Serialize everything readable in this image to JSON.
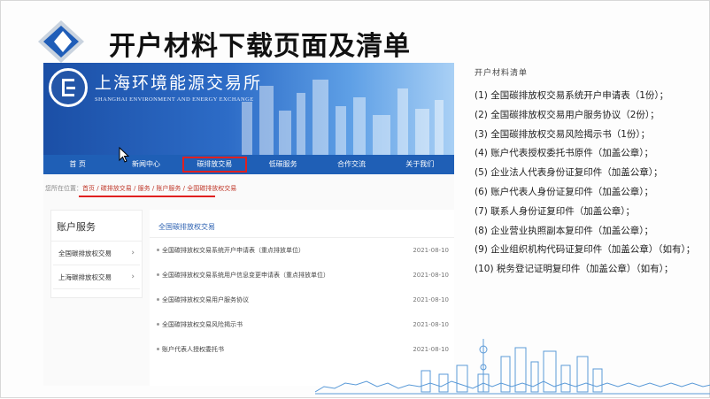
{
  "slide": {
    "title": "开户材料下载页面及清单"
  },
  "site": {
    "name_cn": "上海环境能源交易所",
    "name_en": "SHANGHAI ENVIRONMENT AND ENERGY EXCHANGE",
    "nav": [
      {
        "label": "首 页",
        "active": false
      },
      {
        "label": "新闻中心",
        "active": false
      },
      {
        "label": "碳排放交易",
        "active": true
      },
      {
        "label": "低碳服务",
        "active": false
      },
      {
        "label": "合作交流",
        "active": false
      },
      {
        "label": "关于我们",
        "active": false
      }
    ],
    "breadcrumb_prefix": "您所在位置：",
    "breadcrumb": "首页 / 碳排放交易 / 服务 / 账户服务 / 全国碳排放权交易",
    "sidebar": {
      "title": "账户服务",
      "items": [
        "全国碳排放权交易",
        "上海碳排放权交易"
      ]
    },
    "list": {
      "tab": "全国碳排放权交易",
      "rows": [
        {
          "title": "全国碳排放权交易系统开户申请表（重点排放单位）",
          "date": "2021-08-10"
        },
        {
          "title": "全国碳排放权交易系统用户信息变更申请表（重点排放单位）",
          "date": "2021-08-10"
        },
        {
          "title": "全国碳排放权交易用户服务协议",
          "date": "2021-08-10"
        },
        {
          "title": "全国碳排放权交易风险揭示书",
          "date": "2021-08-10"
        },
        {
          "title": "账户代表人授权委托书",
          "date": "2021-08-10"
        }
      ]
    }
  },
  "checklist": {
    "title": "开户材料清单",
    "items": [
      "(1) 全国碳排放权交易系统开户申请表（1份）；",
      "(2) 全国碳排放权交易用户服务协议（2份）；",
      "(3) 全国碳排放权交易风险揭示书（1份）；",
      "(4) 账户代表授权委托书原件（加盖公章）；",
      "(5) 企业法人代表身份证复印件（加盖公章）；",
      "(6) 账户代表人身份证复印件（加盖公章）；",
      "(7) 联系人身份证复印件（加盖公章）；",
      "(8) 企业营业执照副本复印件（加盖公章）；",
      "(9) 企业组织机构代码证复印件（加盖公章）（如有）；",
      "(10) 税务登记证明复印件（加盖公章）（如有）；"
    ]
  },
  "colors": {
    "banner_blue": "#1f5fb6",
    "highlight_red": "#e02020",
    "logo_blue": "#1f5db8"
  },
  "icons": [
    "slide-logo-icon",
    "emblem-icon",
    "cursor-icon",
    "chevron-right-icon",
    "skyline-illustration"
  ]
}
